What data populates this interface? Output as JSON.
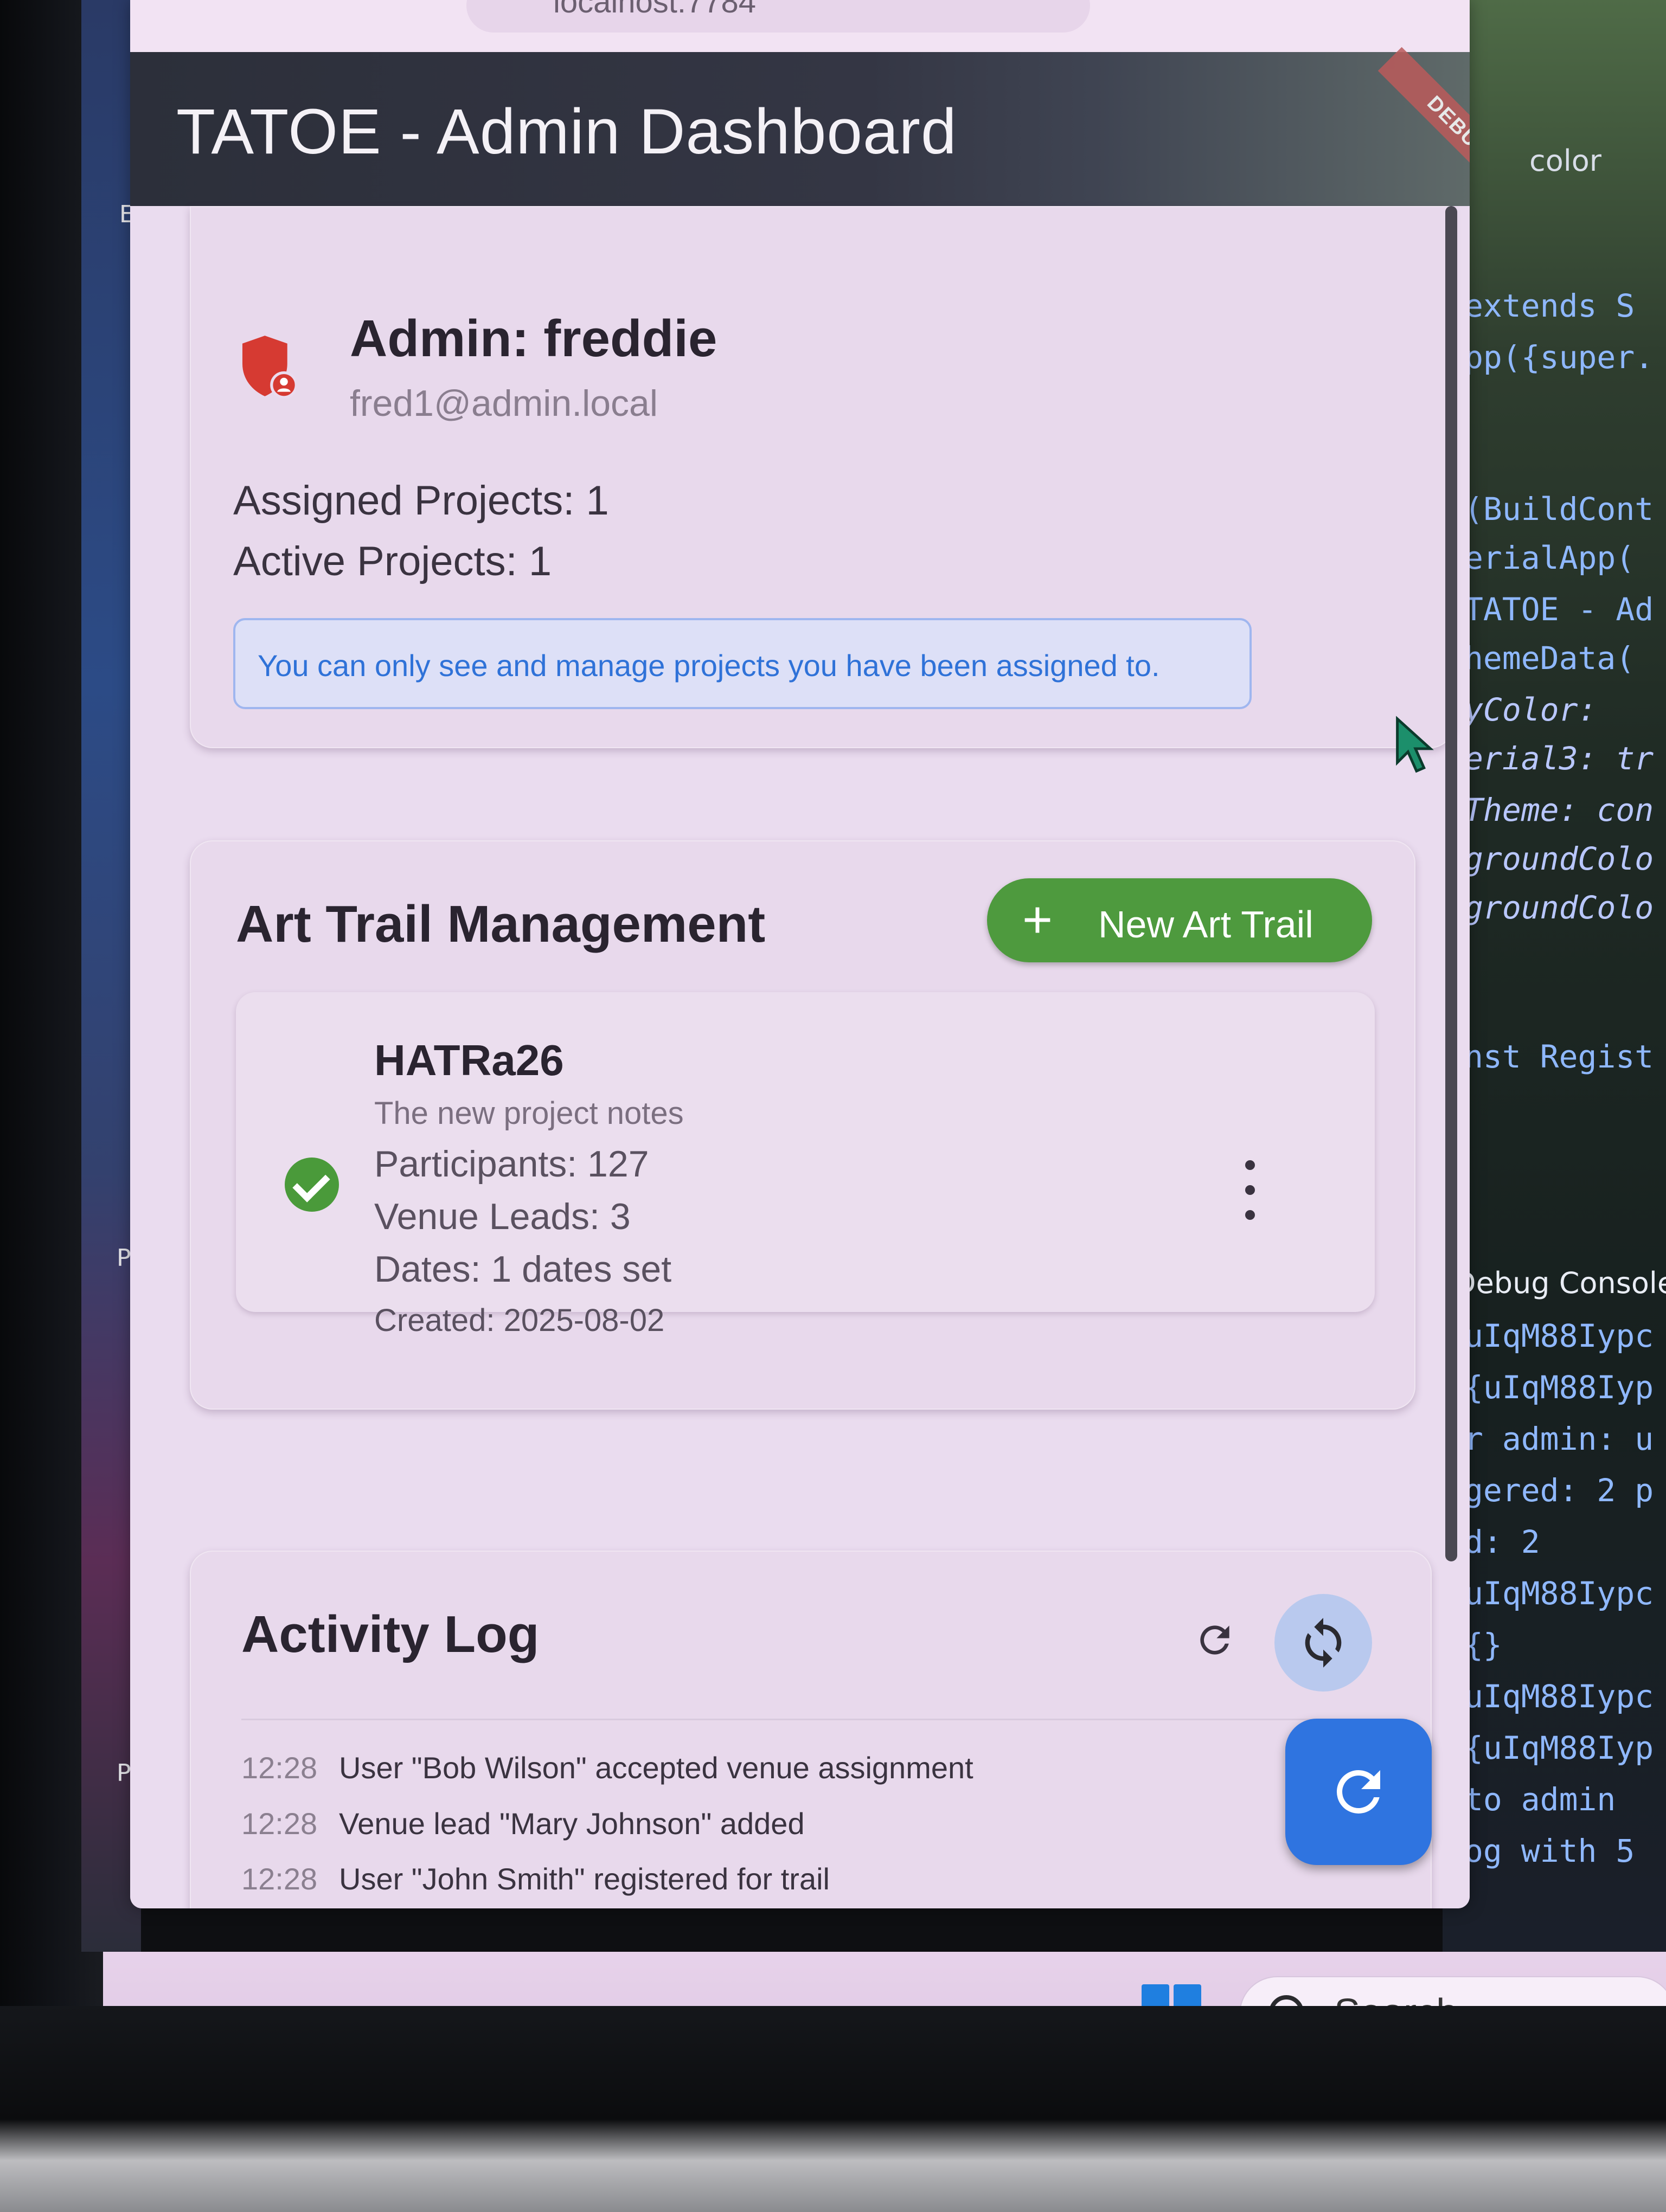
{
  "desktop": {
    "edge_letters": [
      "E",
      "P",
      "P"
    ]
  },
  "ide": {
    "tab_label": "color",
    "code_lines": [
      "extends S",
      "pp({super.",
      "(BuildCont",
      "erialApp(",
      "TATOE - Ad",
      "hemeData(",
      "yColor:",
      "erial3: tr",
      "Theme: con",
      "groundColo",
      "groundColo",
      "nst Regist"
    ],
    "console_header": "Debug Console",
    "console_lines": [
      "uIqM88Iypc",
      "{uIqM88Iyp",
      "r admin: u",
      "gered: 2 p",
      "d: 2",
      "uIqM88Iypc",
      "{}",
      "uIqM88Iypc",
      "{uIqM88Iyp",
      " to admin",
      "og with 5"
    ]
  },
  "browser": {
    "address": "localhost:7784"
  },
  "app": {
    "title": "TATOE - Admin Dashboard",
    "debug_banner": "DEBUG",
    "accent": "#4e9a3e",
    "primary": "#2f74e0"
  },
  "admin": {
    "name": "Admin: freddie",
    "email": "fred1@admin.local",
    "assigned_projects": "Assigned Projects: 1",
    "active_projects": "Active Projects: 1",
    "info": "You can only see and manage projects you have been assigned to."
  },
  "art_trails": {
    "heading": "Art Trail Management",
    "new_button": "New Art Trail",
    "items": [
      {
        "name": "HATRa26",
        "notes": "The new project notes",
        "participants": "Participants: 127",
        "venue_leads": "Venue Leads: 3",
        "dates": "Dates: 1 dates set",
        "created": "Created: 2025-08-02",
        "status_icon": "check-circle-icon"
      }
    ]
  },
  "activity": {
    "heading": "Activity Log",
    "entries": [
      {
        "time": "12:28",
        "message": "User \"Bob Wilson\" accepted venue assignment"
      },
      {
        "time": "12:28",
        "message": "Venue lead \"Mary Johnson\" added"
      },
      {
        "time": "12:28",
        "message": "User \"John Smith\" registered for trail"
      }
    ]
  },
  "taskbar": {
    "search_label": "Search"
  }
}
